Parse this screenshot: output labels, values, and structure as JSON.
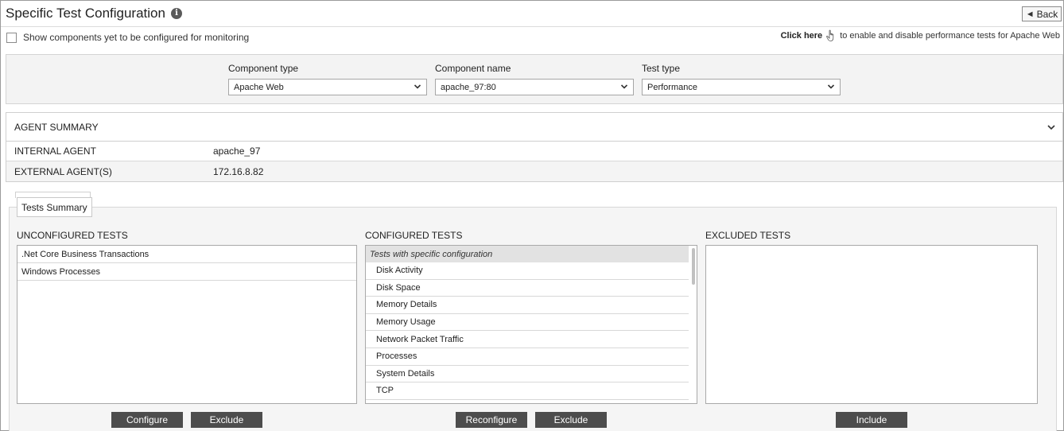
{
  "header": {
    "title": "Specific Test Configuration",
    "back_label": "Back"
  },
  "show_components": {
    "label": "Show components yet to be configured for monitoring",
    "checked": false
  },
  "click_here": {
    "link": "Click here",
    "text": "to enable and disable performance tests for Apache Web"
  },
  "filters": {
    "component_type": {
      "label": "Component type",
      "value": "Apache Web"
    },
    "component_name": {
      "label": "Component name",
      "value": "apache_97:80"
    },
    "test_type": {
      "label": "Test type",
      "value": "Performance"
    }
  },
  "agent_summary": {
    "title": "AGENT SUMMARY",
    "rows": [
      {
        "key": "INTERNAL AGENT",
        "value": "apache_97"
      },
      {
        "key": "EXTERNAL AGENT(S)",
        "value": "172.16.8.82"
      }
    ]
  },
  "tests_summary": {
    "tab_label": "Tests Summary",
    "unconfigured": {
      "label": "UNCONFIGURED TESTS",
      "items": [
        ".Net Core Business Transactions",
        "Windows Processes"
      ]
    },
    "configured": {
      "label": "CONFIGURED TESTS",
      "group": "Tests with specific configuration",
      "items": [
        "Disk Activity",
        "Disk Space",
        "Memory Details",
        "Memory Usage",
        "Network Packet Traffic",
        "Processes",
        "System Details",
        "TCP"
      ]
    },
    "excluded": {
      "label": "EXCLUDED TESTS",
      "items": []
    }
  },
  "buttons": {
    "configure": "Configure",
    "exclude_left": "Exclude",
    "reconfigure": "Reconfigure",
    "exclude_mid": "Exclude",
    "include": "Include"
  },
  "icons": {
    "info": "info-icon",
    "back": "back-arrow-icon",
    "hand": "hand-pointer-icon",
    "dropdown": "chevron-down-icon"
  }
}
